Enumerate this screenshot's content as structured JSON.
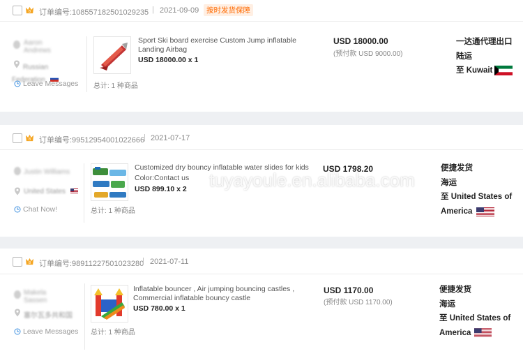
{
  "orders": [
    {
      "order_label": "订单编号:108557182501029235",
      "date": "2021-09-09",
      "badge": "按时发货保障",
      "buyer_name": "Aaron Andrews",
      "buyer_country": "Russian Federation",
      "contact_label": "Leave Messages",
      "product_title": "Sport Ski board exercise Custom Jump inflatable Landing Airbag",
      "product_variant": "",
      "product_price": "USD 18000.00 x 1",
      "total_label": "总计: 1 种商品",
      "amount": "USD 18000.00",
      "deposit": "(预付款 USD 9000.00)",
      "shipping_method": "一达通代理出口",
      "shipping_mode": "陆运",
      "destination": "至 Kuwait"
    },
    {
      "order_label": "订单编号:99512954001022666",
      "date": "2021-07-17",
      "badge": "",
      "buyer_name": "Justin Williams",
      "buyer_country": "United States",
      "contact_label": "Chat Now!",
      "product_title": "Customized dry bouncy inflatable water slides for kids",
      "product_variant": "Color:Contact us",
      "product_price": "USD 899.10 x 2",
      "total_label": "总计: 1 种商品",
      "amount": "USD 1798.20",
      "deposit": "",
      "shipping_method": "便捷发货",
      "shipping_mode": "海运",
      "destination": "至 United States of America"
    },
    {
      "order_label": "订单编号:98911227501023280",
      "date": "2021-07-11",
      "badge": "",
      "buyer_name": "Makela Sassen",
      "buyer_country": "塞尔瓦多共和国",
      "contact_label": "Leave Messages",
      "product_title": "Inflatable bouncer , Air jumping bouncing castles , Commercial inflatable bouncy castle",
      "product_variant": "",
      "product_price": "USD 780.00 x 1",
      "total_label": "总计: 1 种商品",
      "amount": "USD 1170.00",
      "deposit": "(预付款 USD 1170.00)",
      "shipping_method": "便捷发货",
      "shipping_mode": "海运",
      "destination": "至 United States of America"
    }
  ],
  "watermark": "tuyayoule.en.alibaba.com",
  "colors": {
    "accent": "#ff6a00",
    "badge_bg": "#ffefe3",
    "crown": "#f5a623"
  },
  "icons": [
    "checkbox",
    "crown-icon",
    "location-pin-icon",
    "clock-icon",
    "flag-ru-icon",
    "flag-kw-icon",
    "flag-us-icon"
  ]
}
